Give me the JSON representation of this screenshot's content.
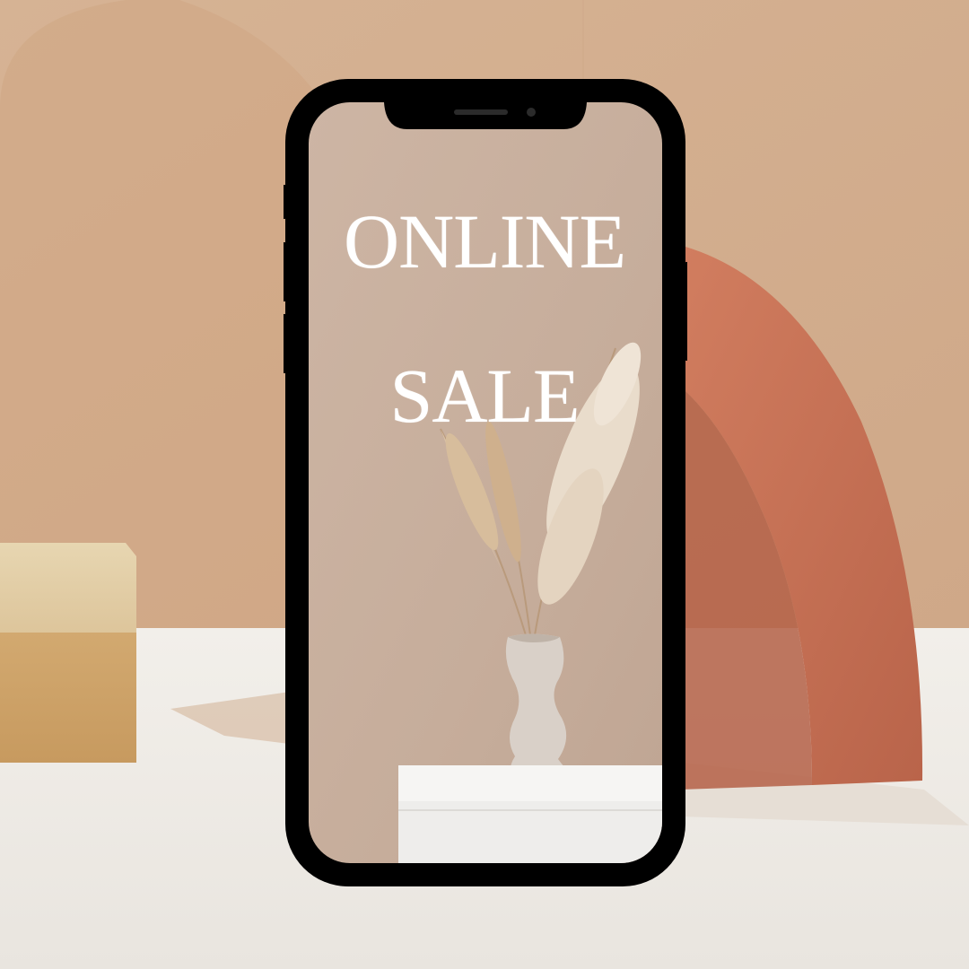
{
  "promo": {
    "line1": "ONLINE",
    "line2": "SALE"
  },
  "colors": {
    "backdrop": "#d9b697",
    "terracotta_arch": "#c9765a",
    "screen_wall": "#c9b1a1",
    "phone_frame": "#000000",
    "text": "#ffffff"
  },
  "icons": {
    "speaker": "speaker-grille-icon",
    "camera": "front-camera-icon"
  }
}
